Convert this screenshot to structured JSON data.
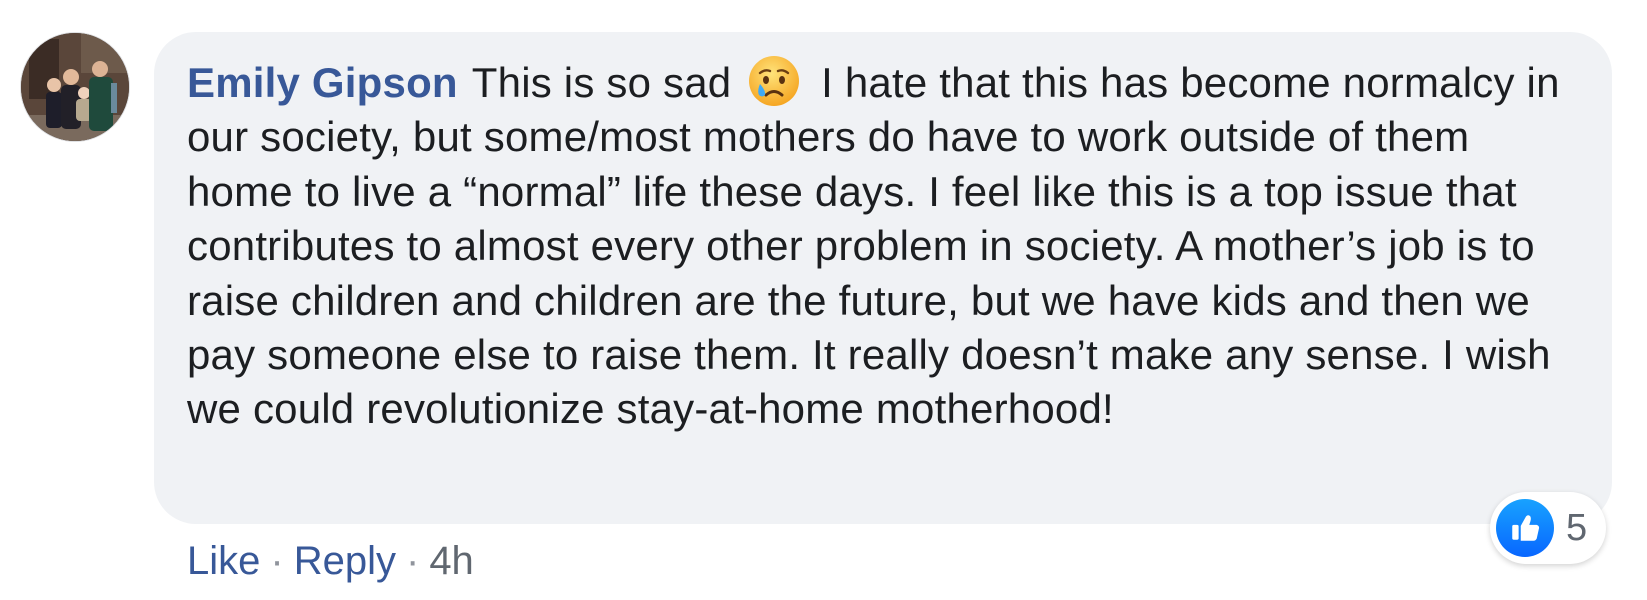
{
  "comment": {
    "author": "Emily Gipson",
    "text_before_emoji": "This is so sad",
    "emoji": "crying-face-emoji",
    "text_after_emoji": "I hate that this has become normalcy in our society, but some/most mothers do have to work outside of them home to live a “normal” life these days. I feel like this is a top issue that contributes to almost every other problem in society. A mother’s job is to raise children and children are the future, but we have kids and then we pay someone else to raise them. It really doesn’t make any sense. I wish we could revolutionize stay-at-home motherhood!",
    "reaction_icon": "like-icon",
    "reaction_count": "5"
  },
  "actions": {
    "like_label": "Like",
    "separator": "·",
    "reply_label": "Reply",
    "timestamp": "4h"
  },
  "colors": {
    "author_link": "#385898",
    "bubble_bg": "#f0f2f5",
    "text": "#1c1e21",
    "like_blue": "#0866ff",
    "meta_gray": "#606770"
  }
}
